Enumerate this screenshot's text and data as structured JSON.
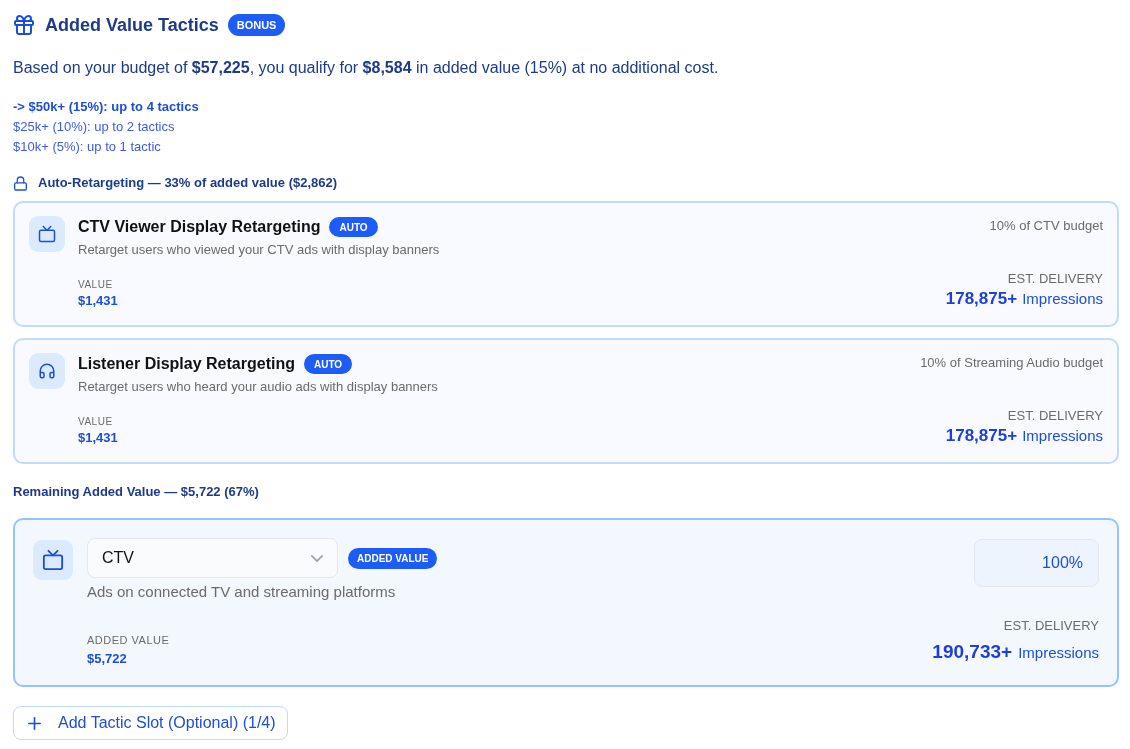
{
  "header": {
    "title": "Added Value Tactics",
    "badge": "BONUS"
  },
  "summary": "Based on your budget of **$57,225**, you qualify for **$8,584** in added value (15%) at no additional cost.",
  "tiers": [
    {
      "label": "-> $50k+ (15%): up to 4 tactics",
      "selected": true
    },
    {
      "label": "$25k+ (10%): up to 2 tactics",
      "selected": false
    },
    {
      "label": "$10k+ (5%): up to 1 tactic",
      "selected": false
    }
  ],
  "auto_retargeting": {
    "heading": "Auto-Retargeting — 33% of added value ($2,862)",
    "tactics": [
      {
        "kind": "tv",
        "title": "CTV Viewer Display Retargeting",
        "badge": "AUTO",
        "description": "Retarget users who viewed your CTV ads with display banners",
        "budget_share": "10% of CTV budget",
        "value_label": "VALUE",
        "value": "$1,431",
        "delivery_label": "EST. DELIVERY",
        "impressions": "178,875+",
        "impressions_unit": "Impressions"
      },
      {
        "kind": "audio",
        "title": "Listener Display Retargeting",
        "badge": "AUTO",
        "description": "Retarget users who heard your audio ads with display banners",
        "budget_share": "10% of Streaming Audio budget",
        "value_label": "VALUE",
        "value": "$1,431",
        "delivery_label": "EST. DELIVERY",
        "impressions": "178,875+",
        "impressions_unit": "Impressions"
      }
    ]
  },
  "remaining": {
    "heading": "Remaining Added Value — $5,722 (67%)",
    "slots": [
      {
        "kind": "tv",
        "channel": "CTV",
        "badge": "ADDED VALUE",
        "description": "Ads on connected TV and streaming platforms",
        "percent": "100%",
        "value_label": "ADDED VALUE",
        "value": "$5,722",
        "delivery_label": "EST. DELIVERY",
        "impressions": "190,733+",
        "impressions_unit": "Impressions"
      }
    ]
  },
  "add_button": {
    "label": "Add Tactic Slot (Optional) (1/4)"
  }
}
